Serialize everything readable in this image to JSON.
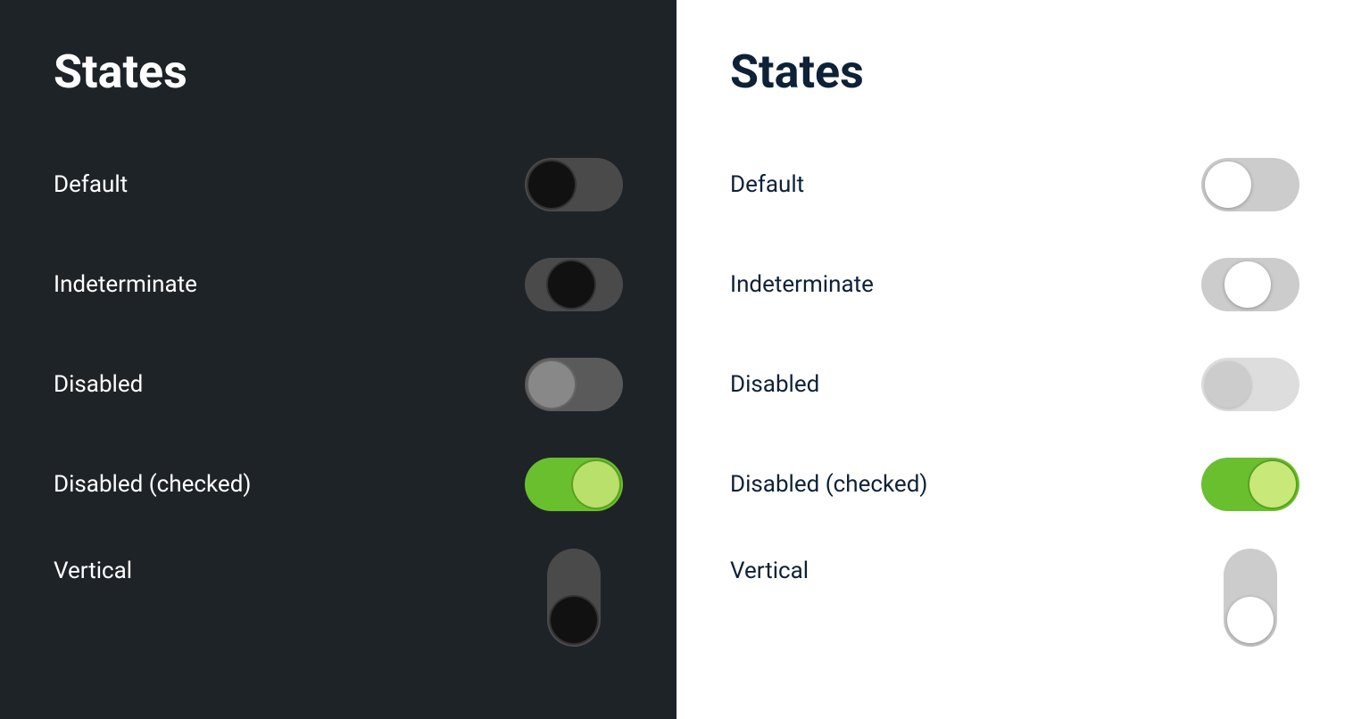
{
  "dark_panel": {
    "title": "States",
    "rows": [
      {
        "id": "default",
        "label": "Default"
      },
      {
        "id": "indeterminate",
        "label": "Indeterminate"
      },
      {
        "id": "disabled",
        "label": "Disabled"
      },
      {
        "id": "disabled-checked",
        "label": "Disabled (checked)"
      },
      {
        "id": "vertical",
        "label": "Vertical"
      }
    ]
  },
  "light_panel": {
    "title": "States",
    "rows": [
      {
        "id": "default",
        "label": "Default"
      },
      {
        "id": "indeterminate",
        "label": "Indeterminate"
      },
      {
        "id": "disabled",
        "label": "Disabled"
      },
      {
        "id": "disabled-checked",
        "label": "Disabled (checked)"
      },
      {
        "id": "vertical",
        "label": "Vertical"
      }
    ]
  }
}
